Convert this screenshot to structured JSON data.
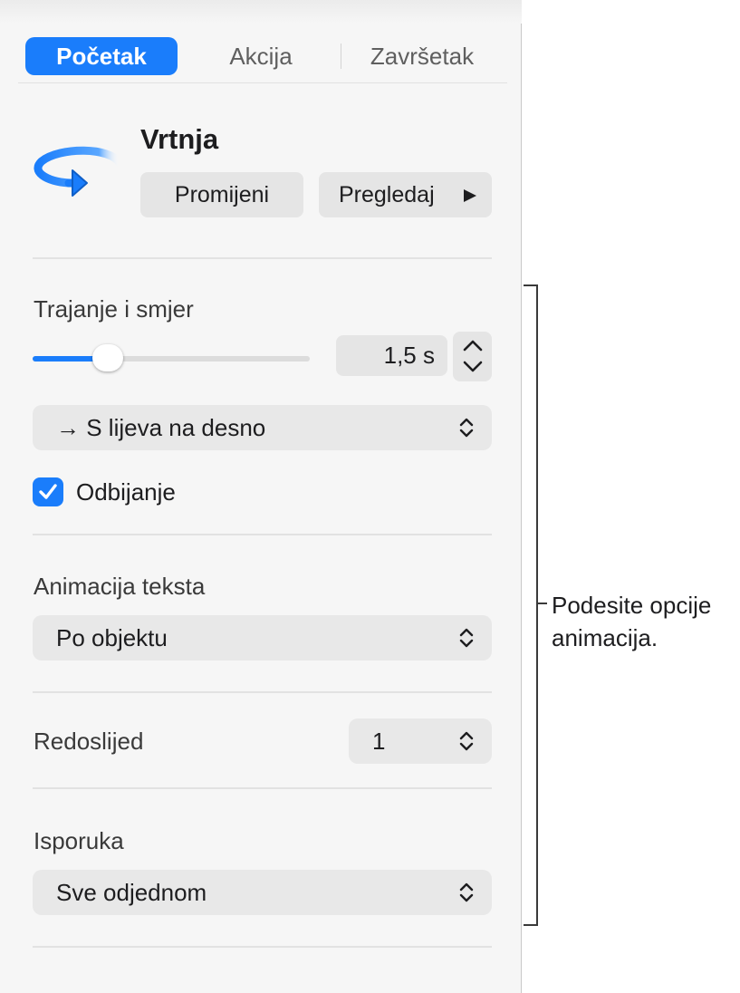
{
  "tabs": [
    {
      "label": "Početak",
      "active": true
    },
    {
      "label": "Akcija",
      "active": false
    },
    {
      "label": "Završetak",
      "active": false
    }
  ],
  "effect": {
    "icon": "rotate-arrow-icon",
    "name": "Vrtnja",
    "change_label": "Promijeni",
    "preview_label": "Pregledaj"
  },
  "duration": {
    "label": "Trajanje i smjer",
    "value": "1,5 s",
    "slider_fraction": 0.27,
    "direction": "→ S lijeva na desno"
  },
  "bounce": {
    "label": "Odbijanje",
    "checked": true
  },
  "text_animation": {
    "label": "Animacija teksta",
    "value": "Po objektu"
  },
  "order": {
    "label": "Redoslijed",
    "value": "1"
  },
  "delivery": {
    "label": "Isporuka",
    "value": "Sve odjednom"
  },
  "callout": {
    "line1": "Podesite opcije",
    "line2": "animacija."
  },
  "colors": {
    "accent": "#1a7dfb",
    "panel": "#f6f6f6",
    "control": "#e8e8e8"
  }
}
